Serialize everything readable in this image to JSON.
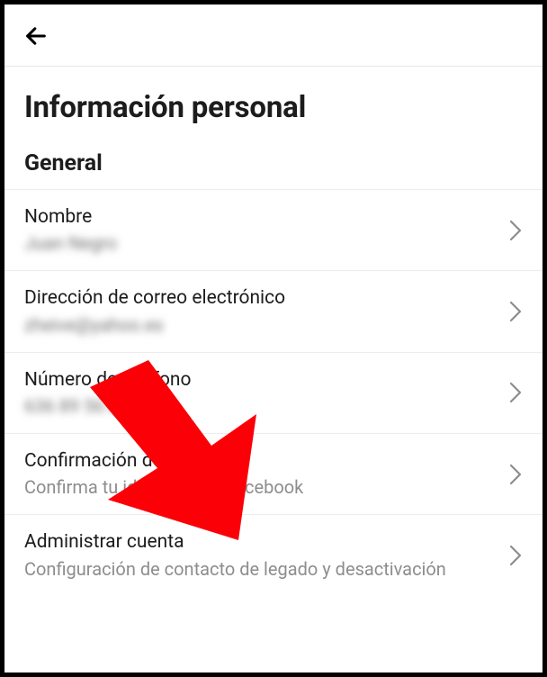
{
  "header": {
    "back_icon": "arrow-left"
  },
  "page": {
    "title": "Información personal"
  },
  "section": {
    "title": "General"
  },
  "rows": {
    "name": {
      "label": "Nombre",
      "value": "Juan Negro"
    },
    "email": {
      "label": "Dirección de correo electrónico",
      "value": "zheive@yahoo.es"
    },
    "phone": {
      "label": "Número de teléfono",
      "value": "636 89 56 00"
    },
    "identity": {
      "label": "Confirmación de identidad",
      "value": "Confirma tu identidad en Facebook"
    },
    "manage": {
      "label": "Administrar cuenta",
      "value": "Configuración de contacto de legado y desactivación"
    }
  },
  "annotation": {
    "arrow_target": "email-row"
  }
}
